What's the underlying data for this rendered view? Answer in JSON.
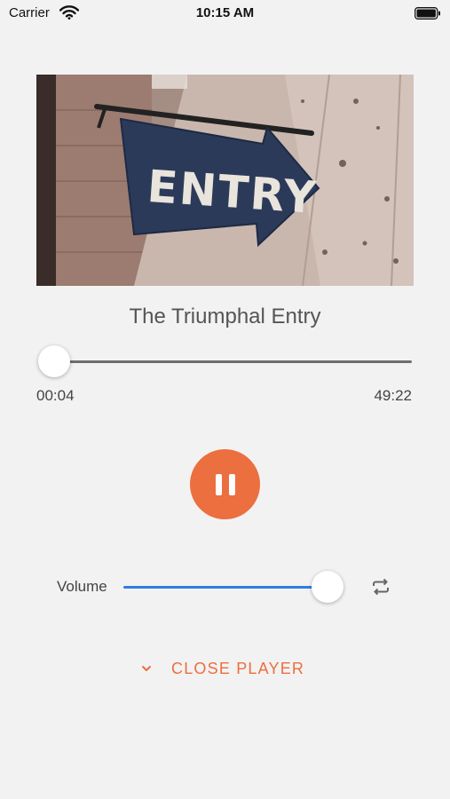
{
  "status_bar": {
    "carrier": "Carrier",
    "time": "10:15 AM"
  },
  "track": {
    "title": "The Triumphal Entry",
    "artwork_sign_text": "ENTRY",
    "elapsed": "00:04",
    "duration": "49:22",
    "progress_fraction": 0.004
  },
  "controls": {
    "play_state": "playing",
    "volume_label": "Volume",
    "volume_fraction": 1.0,
    "repeat_icon": "repeat-icon",
    "close_player_label": "CLOSE PLAYER"
  },
  "colors": {
    "accent": "#ec6f3f",
    "volume_track": "#2f7de0",
    "background": "#f2f2f2"
  }
}
